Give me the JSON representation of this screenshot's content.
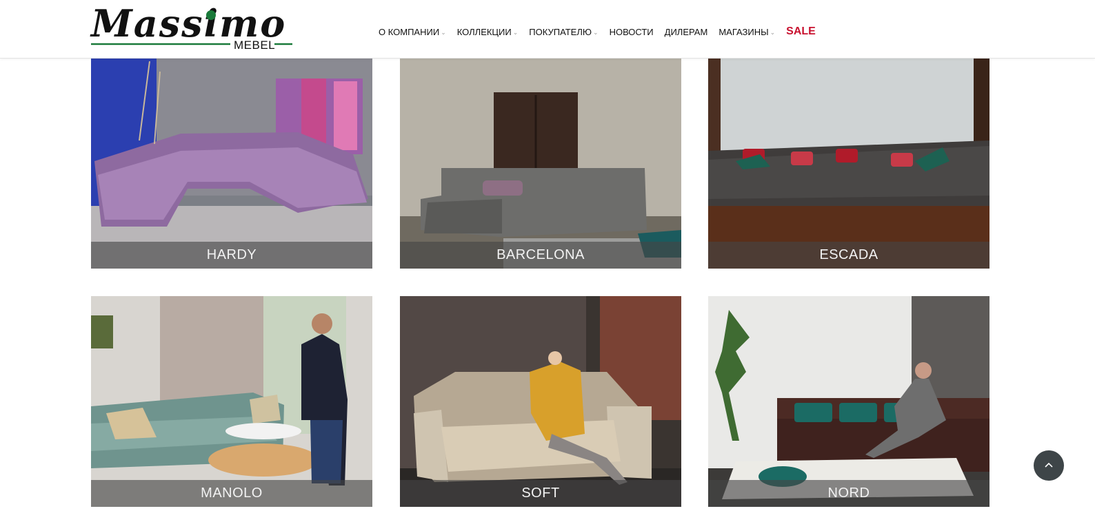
{
  "brand": {
    "name": "Massimo",
    "sub": "MEBEL"
  },
  "nav": {
    "items": [
      {
        "label": "О КОМПАНИИ",
        "has_dropdown": true
      },
      {
        "label": "КОЛЛЕКЦИИ",
        "has_dropdown": true
      },
      {
        "label": "ПОКУПАТЕЛЮ",
        "has_dropdown": true
      },
      {
        "label": "НОВОСТИ",
        "has_dropdown": false
      },
      {
        "label": "ДИЛЕРАМ",
        "has_dropdown": false
      },
      {
        "label": "МАГАЗИНЫ",
        "has_dropdown": true
      }
    ],
    "sale": "SALE",
    "sale_color": "#c8102e"
  },
  "collections": [
    {
      "name": "HARDY"
    },
    {
      "name": "BARCELONA"
    },
    {
      "name": "ESCADA"
    },
    {
      "name": "MANOLO"
    },
    {
      "name": "SOFT"
    },
    {
      "name": "NORD"
    }
  ],
  "icons": {
    "scroll_top": "chevron-up-icon"
  },
  "colors": {
    "logo_green": "#1a7a3a",
    "logo_ink": "#111111"
  }
}
